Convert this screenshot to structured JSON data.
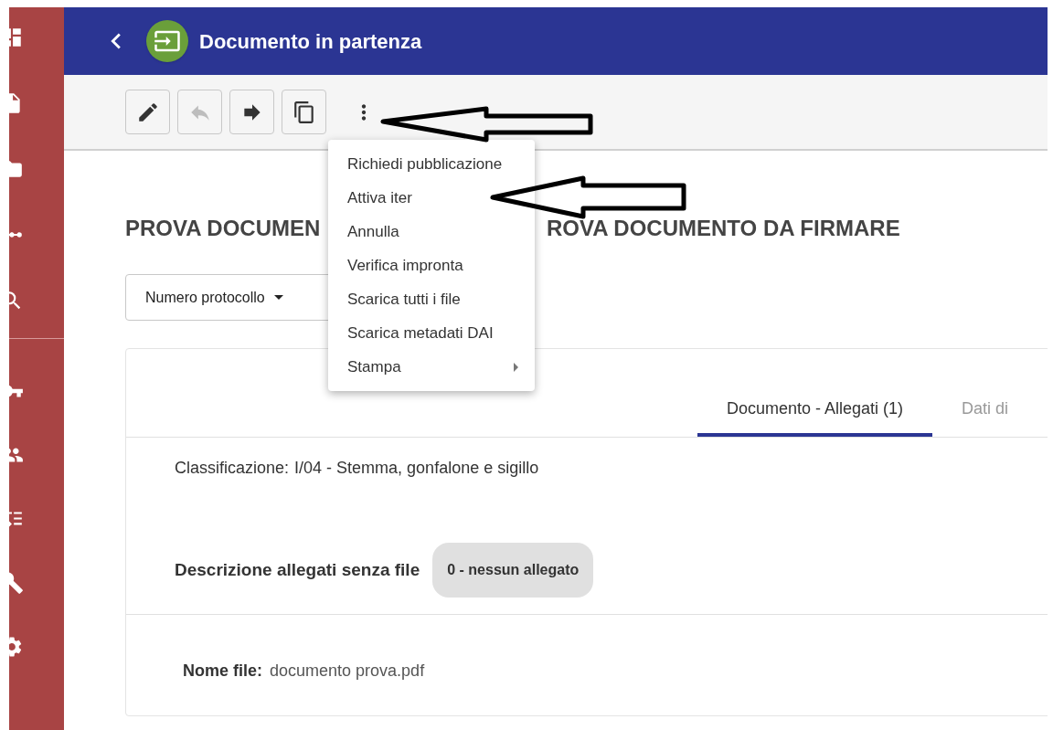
{
  "header": {
    "title": "Documento in partenza"
  },
  "toolbar": [
    {
      "kind": "edit",
      "disabled": false
    },
    {
      "kind": "reply",
      "disabled": true
    },
    {
      "kind": "forward",
      "disabled": false
    },
    {
      "kind": "copy",
      "disabled": false
    }
  ],
  "menu": {
    "items": [
      {
        "label": "Richiedi pubblicazione",
        "submenu": false
      },
      {
        "label": "Attiva iter",
        "submenu": false
      },
      {
        "label": "Annulla",
        "submenu": false
      },
      {
        "label": "Verifica impronta",
        "submenu": false
      },
      {
        "label": "Scarica tutti i file",
        "submenu": false
      },
      {
        "label": "Scarica metadati DAI",
        "submenu": false
      },
      {
        "label": "Stampa",
        "submenu": true
      }
    ]
  },
  "title_parts": [
    "PROVA DOCUMEN",
    "ROVA DOCUMENTO DA FIRMARE"
  ],
  "protocol_dropdown": {
    "label": "Numero protocollo"
  },
  "tabs": [
    {
      "label": "Documento - Allegati (1)",
      "selected": true
    },
    {
      "label": "Dati di",
      "selected": false
    }
  ],
  "classification": {
    "label": "Classificazione:",
    "value": "I/04 - Stemma, gonfalone e sigillo"
  },
  "attachments_description": {
    "label": "Descrizione allegati senza file",
    "chip": "0 - nessun allegato"
  },
  "file": {
    "label": "Nome file:",
    "value": "documento prova.pdf"
  }
}
